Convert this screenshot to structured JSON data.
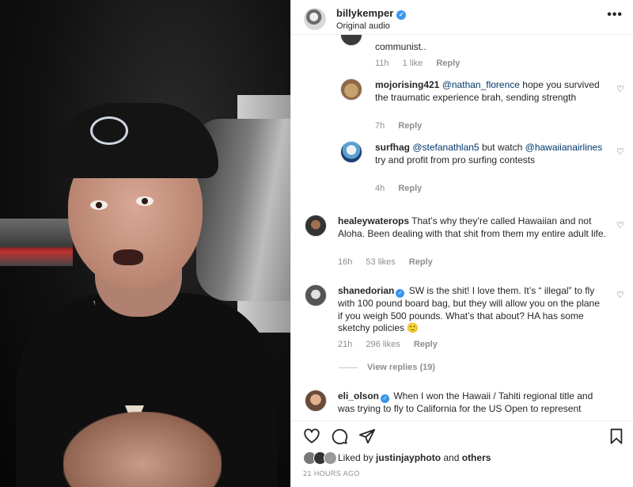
{
  "post": {
    "username": "billykemper",
    "subtitle": "Original audio",
    "verified_mark": "✓",
    "more_icon": "more-horizontal-icon"
  },
  "comments": [
    {
      "username": "",
      "text": "communist..",
      "time": "11h",
      "likes": "1 like",
      "reply": "Reply"
    },
    {
      "username": "mojorising421",
      "mention": "@nathan_florence",
      "text": " hope you survived the traumatic experience brah, sending strength",
      "time": "7h",
      "reply": "Reply"
    },
    {
      "username": "surfhag",
      "mention": "@stefanathlan5",
      "text": " but watch ",
      "mention2": "@hawaiianairlines",
      "text2": " try and profit from pro surfing contests",
      "time": "4h",
      "reply": "Reply"
    },
    {
      "username": "healeywaterops",
      "text": " That’s why they’re called Hawaiian and not Aloha. Been dealing with that shit from them my entire adult life.",
      "time": "16h",
      "likes": "53 likes",
      "reply": "Reply"
    },
    {
      "username": "shanedorian",
      "text": " SW is the shit! I love them. It’s “ illegal” to fly with 100 pound board bag, but they will allow you on the plane if you weigh 500 pounds. What’s that about? HA has some sketchy policies 🙂",
      "time": "21h",
      "likes": "296 likes",
      "reply": "Reply"
    },
    {
      "username": "eli_olson",
      "text": " When I won the Hawaii / Tahiti regional title and was trying to fly to California for the US Open to represent"
    }
  ],
  "view_replies": "View replies (19)",
  "liked_by": {
    "prefix": "Liked by ",
    "user": "justinjayphoto",
    "and": " and ",
    "others": "others"
  },
  "timestamp": "21 HOURS AGO",
  "icons": {
    "heart": "heart-icon",
    "comment": "comment-icon",
    "share": "share-icon",
    "save": "bookmark-icon"
  },
  "colors": {
    "verified": "#3897f0",
    "mention": "#00376b",
    "muted": "#8e8e8e"
  }
}
